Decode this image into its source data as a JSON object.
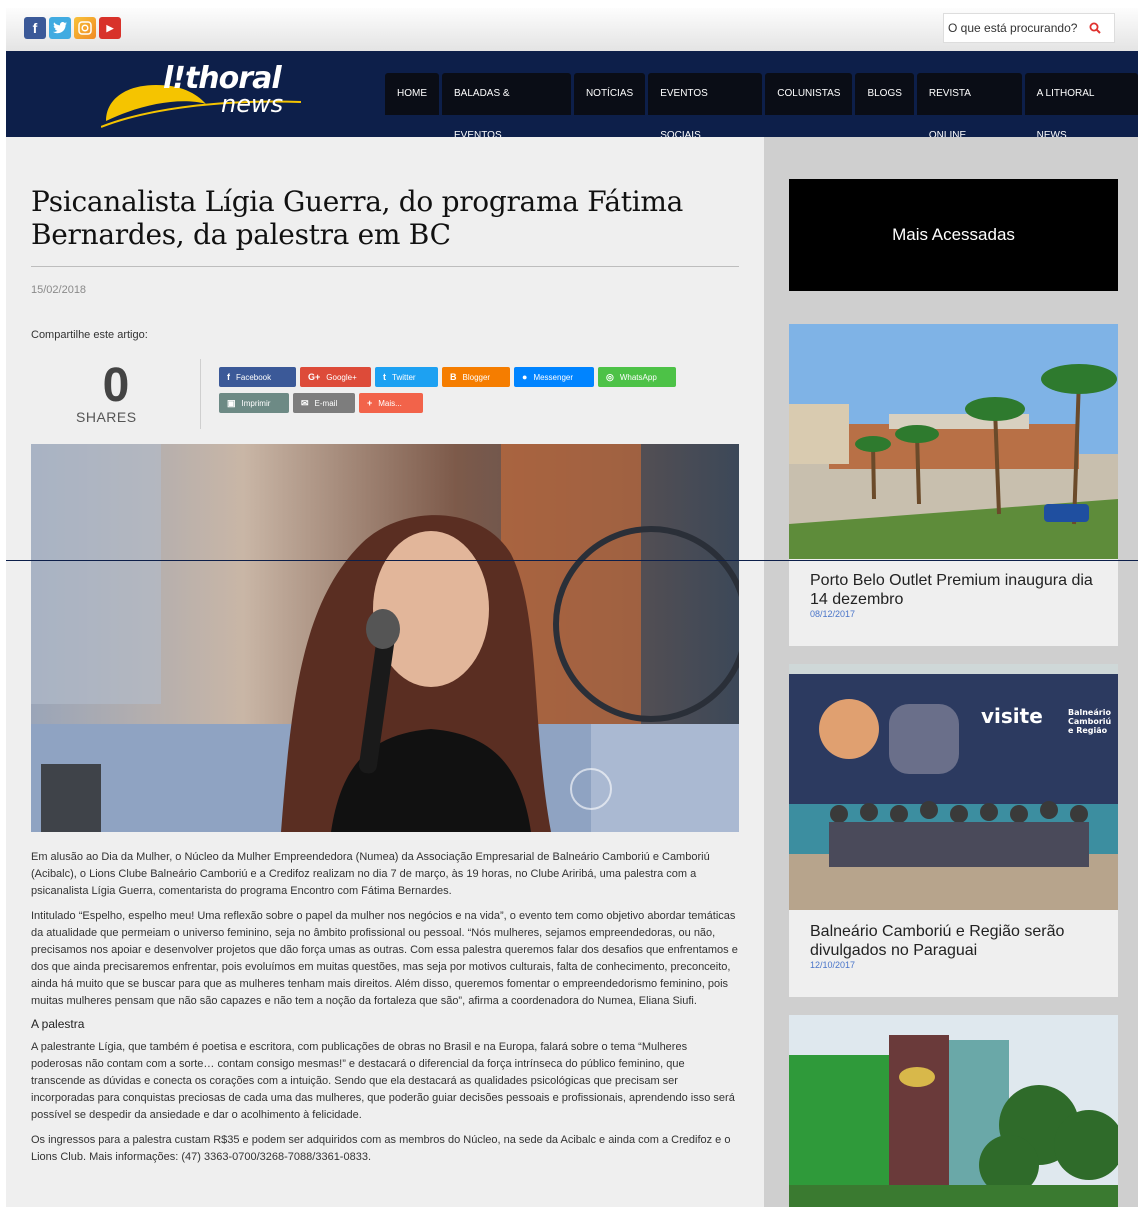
{
  "topbar": {
    "social_icons": [
      "facebook-icon",
      "twitter-icon",
      "instagram-icon",
      "youtube-icon"
    ],
    "search_placeholder": "O que está procurando?"
  },
  "brand": {
    "name_top": "l!thoral",
    "name_bottom": "news",
    "accent": "#f5c400",
    "navy": "#0d1f4a"
  },
  "nav": [
    "HOME",
    "BALADAS & EVENTOS",
    "NOTÍCIAS",
    "EVENTOS SOCIAIS",
    "COLUNISTAS",
    "BLOGS",
    "REVISTA ONLINE",
    "A LITHORAL NEWS"
  ],
  "article": {
    "title": "Psicanalista Lígia Guerra, do programa Fátima Bernardes, da palestra em BC",
    "date": "15/02/2018",
    "share_label": "Compartilhe este artigo:",
    "shares_count": "0",
    "shares_text": "SHARES",
    "share_buttons": [
      {
        "label": "Facebook",
        "icon": "f",
        "color": "#3b5998"
      },
      {
        "label": "Google+",
        "icon": "G+",
        "color": "#dd4b39"
      },
      {
        "label": "Twitter",
        "icon": "t",
        "color": "#1da1f2"
      },
      {
        "label": "Blogger",
        "icon": "B",
        "color": "#f57d00"
      },
      {
        "label": "Messenger",
        "icon": "m",
        "color": "#0084ff"
      },
      {
        "label": "WhatsApp",
        "icon": "w",
        "color": "#4dc247"
      },
      {
        "label": "Imprimir",
        "icon": "p",
        "color": "#6d8a85"
      },
      {
        "label": "E-mail",
        "icon": "@",
        "color": "#7d7d7d"
      },
      {
        "label": "Mais...",
        "icon": "+",
        "color": "#f2634a"
      }
    ],
    "paragraphs": [
      "Em alusão ao Dia da Mulher, o Núcleo da Mulher Empreendedora (Numea) da Associação Empresarial de Balneário Camboriú e Camboriú (Acibalc), o Lions Clube Balneário Camboriú e a Credifoz realizam no dia 7 de março, às 19 horas, no Clube Ariribá, uma palestra com a psicanalista Lígia Guerra, comentarista do programa Encontro com Fátima Bernardes.",
      "Intitulado “Espelho, espelho meu! Uma reflexão sobre o papel da mulher nos negócios e na vida”, o evento tem como objetivo abordar temáticas da atualidade que permeiam o universo feminino, seja no âmbito profissional ou pessoal. “Nós mulheres, sejamos empreendedoras, ou não, precisamos nos apoiar e desenvolver projetos que dão força umas as outras. Com essa palestra queremos falar dos desafios que enfrentamos e dos que ainda precisaremos enfrentar, pois evoluímos em muitas questões, mas seja por motivos culturais, falta de conhecimento, preconceito, ainda há muito que se buscar para que as mulheres tenham mais direitos. Além disso, queremos fomentar o empreendedorismo feminino, pois muitas mulheres pensam que não são capazes e não tem a noção da fortaleza que são”, afirma a coordenadora do Numea, Eliana Siufi."
    ],
    "subheading": "A palestra",
    "paragraphs2": [
      "A palestrante Lígia, que também é poetisa e escritora, com publicações de obras no Brasil e na Europa, falará sobre o tema “Mulheres poderosas não contam com a sorte… contam consigo mesmas!” e destacará o diferencial da força intrínseca do público feminino, que transcende as dúvidas e conecta os corações com a intuição. Sendo que ela destacará as qualidades psicológicas que precisam ser incorporadas para conquistas preciosas de cada uma das mulheres, que poderão guiar decisões pessoais e profissionais, aprendendo isso será possível se despedir da ansiedade e dar o acolhimento à felicidade.",
      "Os ingressos para a palestra custam R$35 e podem ser adquiridos com as membros do Núcleo, na sede da Acibalc e ainda com a Credifoz e o Lions Club. Mais informações: (47) 3363-0700/3268-7088/3361-0833."
    ]
  },
  "sidebar": {
    "heading": "Mais Acessadas",
    "cards": [
      {
        "title": "Porto Belo Outlet Premium inaugura dia 14 dezembro",
        "date": "08/12/2017"
      },
      {
        "title": "Balneário Camboriú e Região serão divulgados no Paraguai",
        "date": "12/10/2017"
      }
    ],
    "bus_text": "visite",
    "bus_text2": "Balneário Camboriú e Região"
  }
}
